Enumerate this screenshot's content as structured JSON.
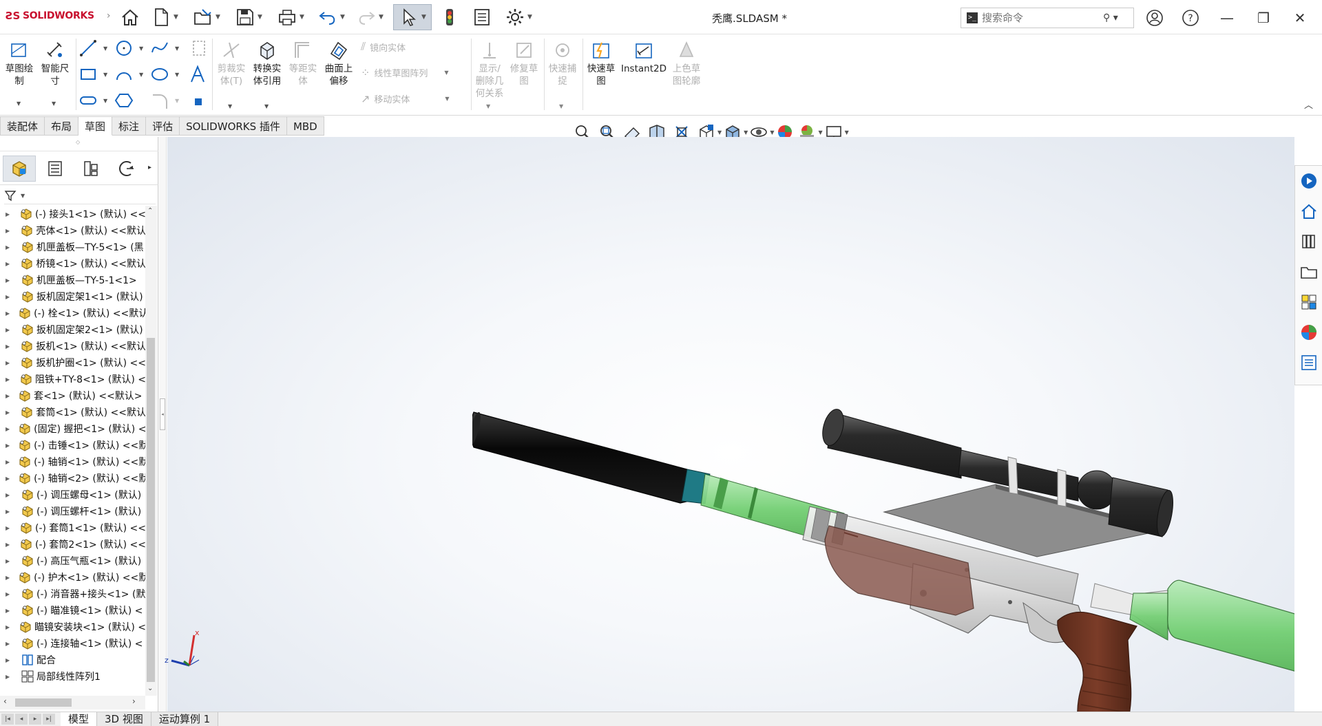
{
  "app": {
    "logo_text": "SOLIDWORKS",
    "document_title": "秃鹰.SLDASM *",
    "search_placeholder": "搜索命令"
  },
  "ribbon": {
    "buttons": [
      {
        "label": "草图绘\n制",
        "enabled": true
      },
      {
        "label": "智能尺\n寸",
        "enabled": true
      },
      {
        "label": "剪裁实\n体(T)",
        "enabled": false
      },
      {
        "label": "转换实\n体引用",
        "enabled": true
      },
      {
        "label": "等距实\n体",
        "enabled": false
      },
      {
        "label": "曲面上\n偏移",
        "enabled": true
      },
      {
        "label": "显示/\n删除几\n何关系",
        "enabled": false
      },
      {
        "label": "修复草\n图",
        "enabled": false
      },
      {
        "label": "快速捕\n捉",
        "enabled": false
      },
      {
        "label": "快速草\n图",
        "enabled": true
      },
      {
        "label": "Instant2D",
        "enabled": true
      },
      {
        "label": "上色草\n图轮廓",
        "enabled": false
      }
    ],
    "small_buttons": [
      "镜向实体",
      "线性草图阵列",
      "移动实体"
    ]
  },
  "command_tabs": [
    "装配体",
    "布局",
    "草图",
    "标注",
    "评估",
    "SOLIDWORKS 插件",
    "MBD"
  ],
  "active_command_tab": "草图",
  "feature_tree": [
    "(-) 接头1<1> (默认) <<",
    "壳体<1> (默认) <<默认",
    "机匣盖板—TY-5<1> (黑",
    "桥镜<1> (默认) <<默认",
    "机匣盖板—TY-5-1<1>",
    "扳机固定架1<1> (默认)",
    "(-) 栓<1> (默认) <<默认",
    "扳机固定架2<1> (默认)",
    "扳机<1> (默认) <<默认",
    "扳机护圈<1> (默认) <<",
    "阻铁+TY-8<1> (默认) <",
    "套<1> (默认) <<默认> <",
    "套筒<1> (默认) <<默认",
    "(固定) 握把<1> (默认) <",
    "(-) 击锤<1> (默认) <<默",
    "(-) 轴销<1> (默认) <<默",
    "(-) 轴销<2> (默认) <<默",
    "(-) 调压螺母<1> (默认)",
    "(-) 调压螺杆<1> (默认)",
    "(-) 套筒1<1> (默认) <<",
    "(-) 套筒2<1> (默认) <<",
    "(-) 高压气瓶<1> (默认)",
    "(-) 护木<1> (默认) <<默",
    "(-) 消音器+接头<1> (默",
    "(-) 瞄准镜<1> (默认) <",
    "瞄镜安装块<1> (默认) <",
    "(-) 连接轴<1> (默认) <",
    "配合",
    "局部线性阵列1"
  ],
  "triad": {
    "x_label": "x",
    "z_label": "z"
  },
  "bottom_tabs": [
    "模型",
    "3D 视图",
    "运动算例 1"
  ],
  "active_bottom_tab": "模型",
  "colors": {
    "suppressor": "#111111",
    "barrel_green": "#6fce6f",
    "handguard": "#7a4a3e",
    "grip": "#6b3322",
    "scope": "#2a2a2a",
    "receiver": "#d8d8d8",
    "accent_red": "#c8102e"
  }
}
